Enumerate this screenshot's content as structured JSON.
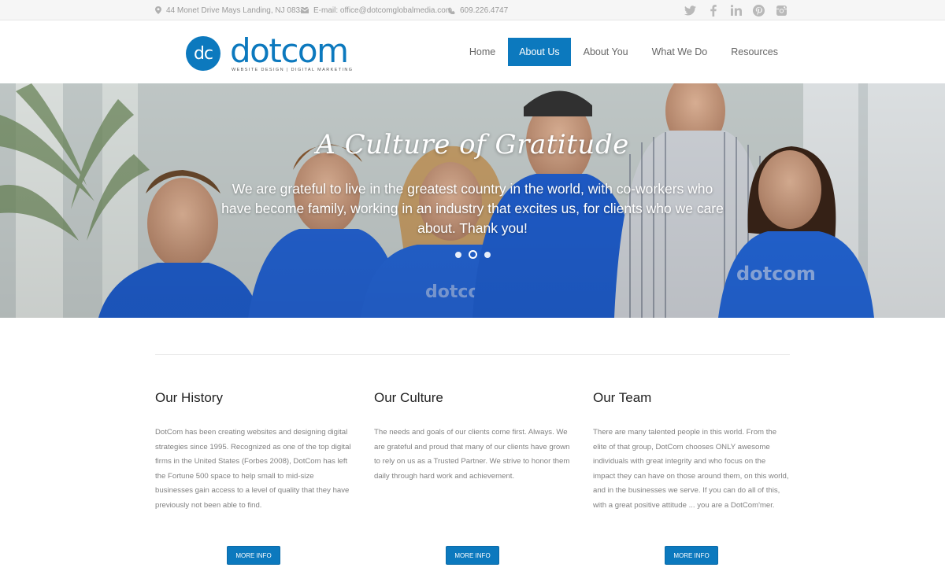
{
  "topbar": {
    "address": "44 Monet Drive Mays Landing, NJ 08330",
    "email": "E-mail: office@dotcomglobalmedia.com",
    "phone": "609.226.4747",
    "social_icons": [
      "twitter-icon",
      "facebook-icon",
      "linkedin-icon",
      "pinterest-icon",
      "instagram-icon"
    ]
  },
  "logo": {
    "monogram": "dc",
    "word": "dotcom",
    "tagline": "WEBSITE DESIGN | DIGITAL MARKETING"
  },
  "nav": {
    "items": [
      "Home",
      "About Us",
      "About You",
      "What We Do",
      "Resources"
    ],
    "active": "About Us"
  },
  "hero": {
    "title": "A Culture of Gratitude",
    "text": "We are grateful to live in the greatest country in the world, with co-workers who have become family, working in an industry that excites us, for clients who we care about. Thank you!",
    "shirt_text": "dotcom",
    "slides": 3,
    "active_slide": 2
  },
  "columns": [
    {
      "title": "Our History",
      "text": "DotCom has been creating websites and designing digital strategies since 1995. Recognized as one of the top digital firms in the United States (Forbes 2008), DotCom has left the Fortune 500 space to help small to mid-size businesses gain access to a level of quality that they have previously not been able to find.",
      "button": "MORE INFO"
    },
    {
      "title": "Our Culture",
      "text": "The needs and goals of our clients come first. Always. We are grateful and proud that many of our clients have grown to rely on us as a Trusted Partner. We strive to honor them daily through hard work and achievement.",
      "button": "MORE INFO"
    },
    {
      "title": "Our Team",
      "text": "There are many talented people in this world. From the elite of that group, DotCom chooses ONLY awesome individuals with great integrity and who focus on the impact they can have on those around them, on this world, and in the businesses we serve. If you can do all of this, with a great positive attitude ... you are a DotCom'mer.",
      "button": "MORE INFO"
    }
  ],
  "colors": {
    "brand": "#0c79be",
    "shirt": "#1f5fd0"
  }
}
